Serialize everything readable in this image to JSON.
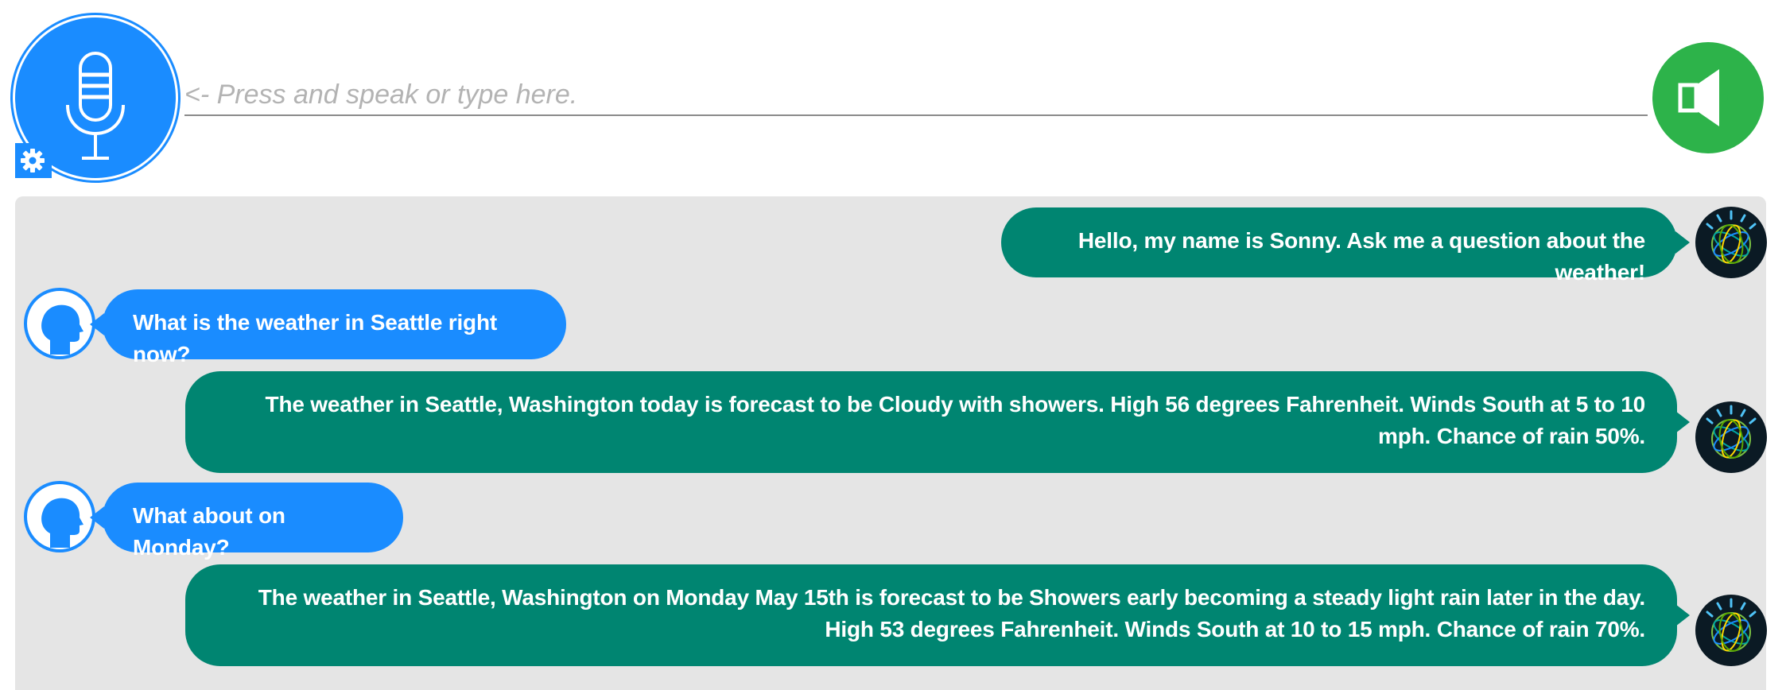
{
  "input": {
    "placeholder": "<- Press and speak or type here.",
    "value": ""
  },
  "icons": {
    "mic": "microphone-icon",
    "settings": "gear-icon",
    "speaker": "speaker-icon",
    "bot_avatar": "watson-avatar-icon",
    "user_avatar": "user-head-icon"
  },
  "colors": {
    "mic_button": "#1a8cff",
    "speaker_button": "#2db34a",
    "bot_bubble": "#008571",
    "user_bubble": "#1a8cff",
    "chat_background": "#e5e5e5"
  },
  "conversation": [
    {
      "sender": "bot",
      "text": "Hello, my name is Sonny. Ask me a question about the weather!"
    },
    {
      "sender": "user",
      "text": "What is the weather in Seattle right now?"
    },
    {
      "sender": "bot",
      "text": "The weather in Seattle, Washington today is forecast to be Cloudy with showers. High 56 degrees Fahrenheit. Winds South at 5 to 10 mph. Chance of rain 50%."
    },
    {
      "sender": "user",
      "text": "What about on Monday?"
    },
    {
      "sender": "bot",
      "text": "The weather in Seattle, Washington on Monday May 15th is forecast to be Showers early becoming a steady light rain later in the day. High 53 degrees Fahrenheit. Winds South at 10 to 15 mph. Chance of rain 70%."
    }
  ]
}
